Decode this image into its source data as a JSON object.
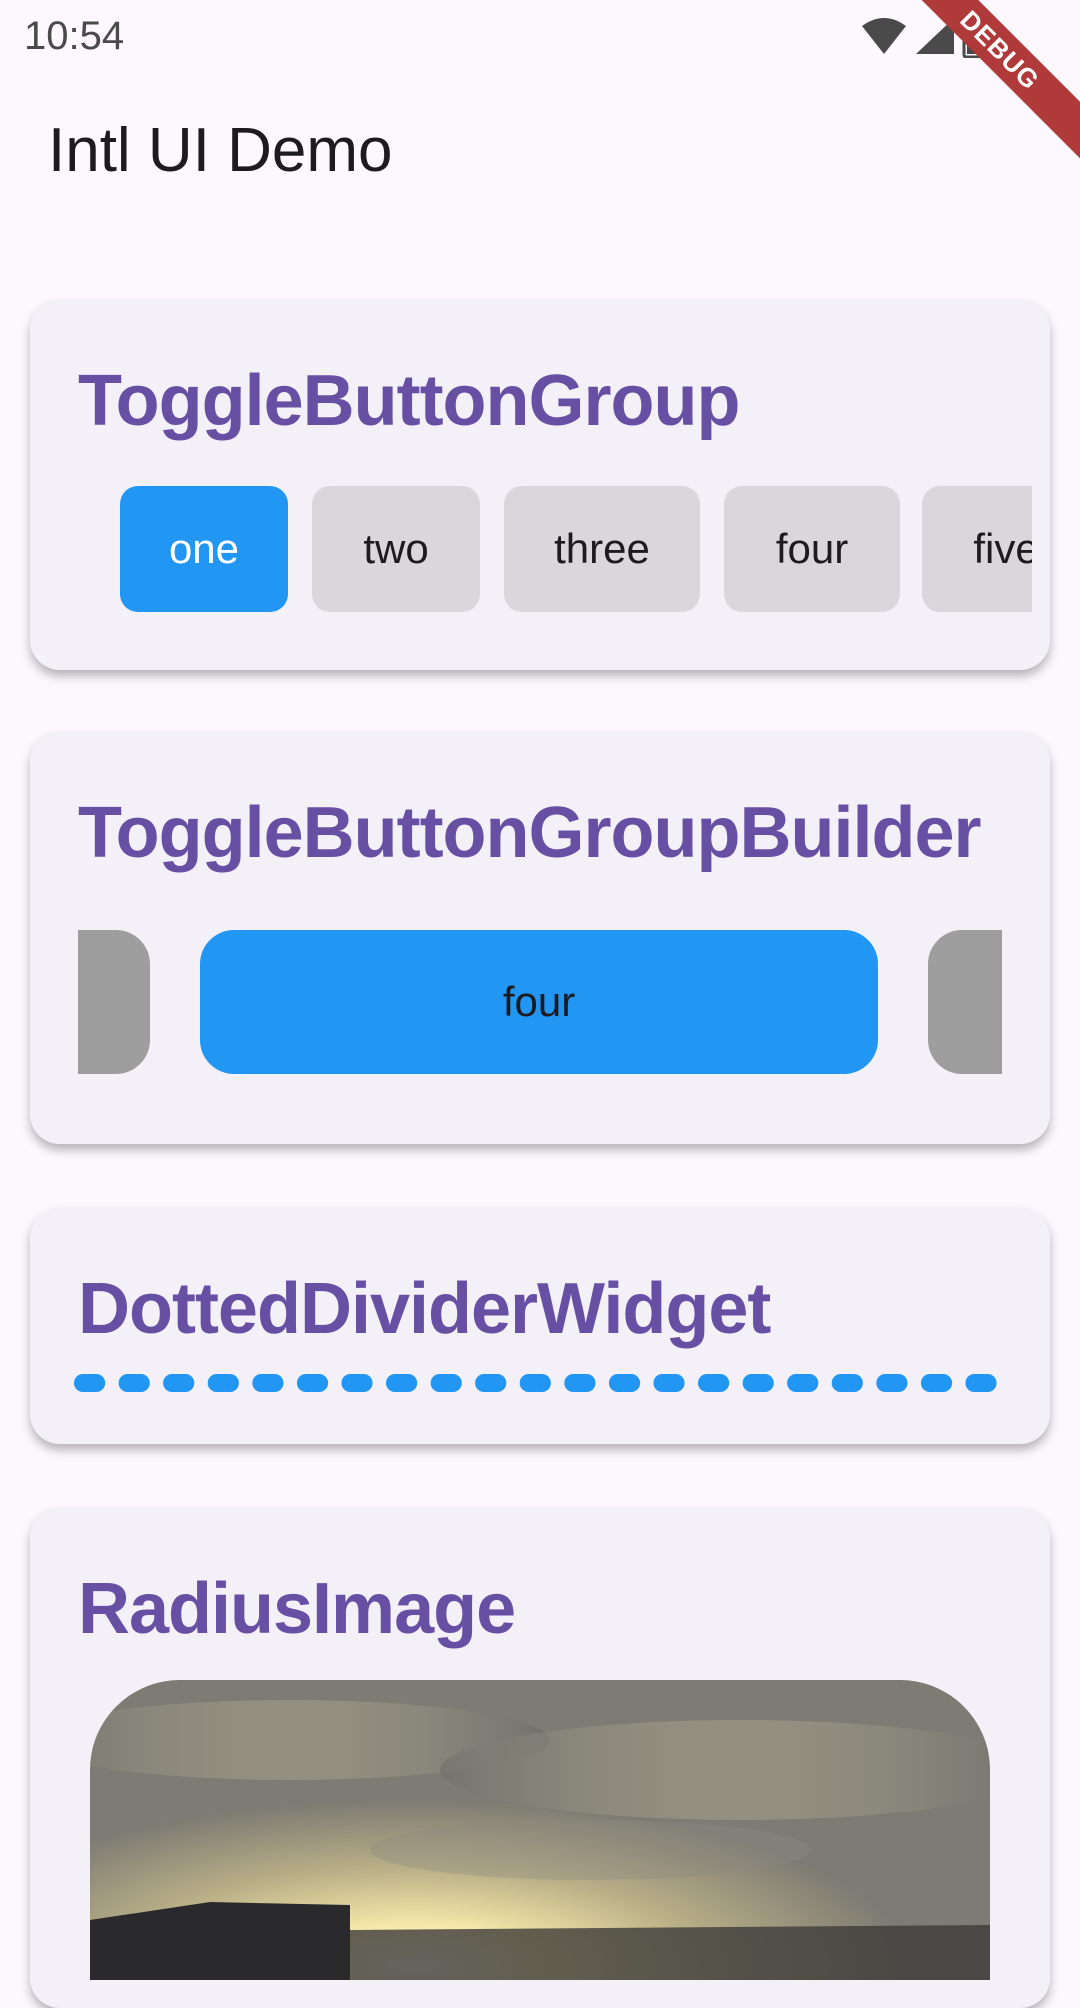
{
  "status_bar": {
    "time": "10:54",
    "icons": [
      "wifi-icon",
      "signal-icon",
      "battery-icon"
    ],
    "debug_label": "DEBUG"
  },
  "app_bar": {
    "title": "Intl UI Demo"
  },
  "colors": {
    "accent": "#6750a4",
    "selected": "#2196f3",
    "unselected": "#d9d6dc",
    "builder_unselected": "#9e9e9e",
    "card": "#f4f0f7",
    "background": "#fdf7fe"
  },
  "toggle_button_group": {
    "title": "ToggleButtonGroup",
    "buttons": [
      {
        "label": "one",
        "selected": true
      },
      {
        "label": "two",
        "selected": false
      },
      {
        "label": "three",
        "selected": false
      },
      {
        "label": "four",
        "selected": false
      },
      {
        "label": "five",
        "selected": false
      }
    ]
  },
  "toggle_button_group_builder": {
    "title": "ToggleButtonGroupBuilder",
    "selected_label": "four"
  },
  "dotted_divider": {
    "title": "DottedDividerWidget",
    "dash_count": 21
  },
  "radius_image": {
    "title": "RadiusImage",
    "content": "sunset-sky-photo"
  }
}
